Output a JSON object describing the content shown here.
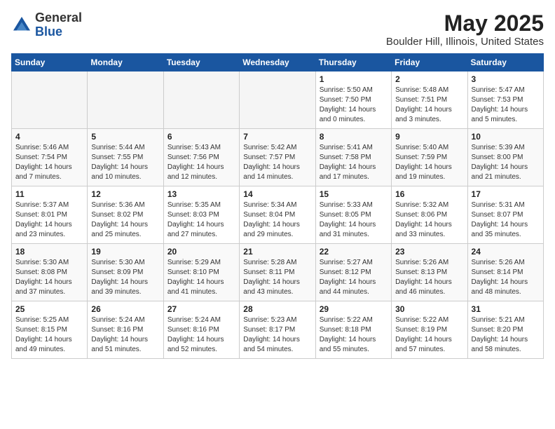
{
  "header": {
    "logo_line1": "General",
    "logo_line2": "Blue",
    "month": "May 2025",
    "location": "Boulder Hill, Illinois, United States"
  },
  "weekdays": [
    "Sunday",
    "Monday",
    "Tuesday",
    "Wednesday",
    "Thursday",
    "Friday",
    "Saturday"
  ],
  "weeks": [
    [
      {
        "day": "",
        "empty": true
      },
      {
        "day": "",
        "empty": true
      },
      {
        "day": "",
        "empty": true
      },
      {
        "day": "",
        "empty": true
      },
      {
        "day": "1",
        "sunrise": "5:50 AM",
        "sunset": "7:50 PM",
        "daylight": "14 hours and 0 minutes."
      },
      {
        "day": "2",
        "sunrise": "5:48 AM",
        "sunset": "7:51 PM",
        "daylight": "14 hours and 3 minutes."
      },
      {
        "day": "3",
        "sunrise": "5:47 AM",
        "sunset": "7:53 PM",
        "daylight": "14 hours and 5 minutes."
      }
    ],
    [
      {
        "day": "4",
        "sunrise": "5:46 AM",
        "sunset": "7:54 PM",
        "daylight": "14 hours and 7 minutes."
      },
      {
        "day": "5",
        "sunrise": "5:44 AM",
        "sunset": "7:55 PM",
        "daylight": "14 hours and 10 minutes."
      },
      {
        "day": "6",
        "sunrise": "5:43 AM",
        "sunset": "7:56 PM",
        "daylight": "14 hours and 12 minutes."
      },
      {
        "day": "7",
        "sunrise": "5:42 AM",
        "sunset": "7:57 PM",
        "daylight": "14 hours and 14 minutes."
      },
      {
        "day": "8",
        "sunrise": "5:41 AM",
        "sunset": "7:58 PM",
        "daylight": "14 hours and 17 minutes."
      },
      {
        "day": "9",
        "sunrise": "5:40 AM",
        "sunset": "7:59 PM",
        "daylight": "14 hours and 19 minutes."
      },
      {
        "day": "10",
        "sunrise": "5:39 AM",
        "sunset": "8:00 PM",
        "daylight": "14 hours and 21 minutes."
      }
    ],
    [
      {
        "day": "11",
        "sunrise": "5:37 AM",
        "sunset": "8:01 PM",
        "daylight": "14 hours and 23 minutes."
      },
      {
        "day": "12",
        "sunrise": "5:36 AM",
        "sunset": "8:02 PM",
        "daylight": "14 hours and 25 minutes."
      },
      {
        "day": "13",
        "sunrise": "5:35 AM",
        "sunset": "8:03 PM",
        "daylight": "14 hours and 27 minutes."
      },
      {
        "day": "14",
        "sunrise": "5:34 AM",
        "sunset": "8:04 PM",
        "daylight": "14 hours and 29 minutes."
      },
      {
        "day": "15",
        "sunrise": "5:33 AM",
        "sunset": "8:05 PM",
        "daylight": "14 hours and 31 minutes."
      },
      {
        "day": "16",
        "sunrise": "5:32 AM",
        "sunset": "8:06 PM",
        "daylight": "14 hours and 33 minutes."
      },
      {
        "day": "17",
        "sunrise": "5:31 AM",
        "sunset": "8:07 PM",
        "daylight": "14 hours and 35 minutes."
      }
    ],
    [
      {
        "day": "18",
        "sunrise": "5:30 AM",
        "sunset": "8:08 PM",
        "daylight": "14 hours and 37 minutes."
      },
      {
        "day": "19",
        "sunrise": "5:30 AM",
        "sunset": "8:09 PM",
        "daylight": "14 hours and 39 minutes."
      },
      {
        "day": "20",
        "sunrise": "5:29 AM",
        "sunset": "8:10 PM",
        "daylight": "14 hours and 41 minutes."
      },
      {
        "day": "21",
        "sunrise": "5:28 AM",
        "sunset": "8:11 PM",
        "daylight": "14 hours and 43 minutes."
      },
      {
        "day": "22",
        "sunrise": "5:27 AM",
        "sunset": "8:12 PM",
        "daylight": "14 hours and 44 minutes."
      },
      {
        "day": "23",
        "sunrise": "5:26 AM",
        "sunset": "8:13 PM",
        "daylight": "14 hours and 46 minutes."
      },
      {
        "day": "24",
        "sunrise": "5:26 AM",
        "sunset": "8:14 PM",
        "daylight": "14 hours and 48 minutes."
      }
    ],
    [
      {
        "day": "25",
        "sunrise": "5:25 AM",
        "sunset": "8:15 PM",
        "daylight": "14 hours and 49 minutes."
      },
      {
        "day": "26",
        "sunrise": "5:24 AM",
        "sunset": "8:16 PM",
        "daylight": "14 hours and 51 minutes."
      },
      {
        "day": "27",
        "sunrise": "5:24 AM",
        "sunset": "8:16 PM",
        "daylight": "14 hours and 52 minutes."
      },
      {
        "day": "28",
        "sunrise": "5:23 AM",
        "sunset": "8:17 PM",
        "daylight": "14 hours and 54 minutes."
      },
      {
        "day": "29",
        "sunrise": "5:22 AM",
        "sunset": "8:18 PM",
        "daylight": "14 hours and 55 minutes."
      },
      {
        "day": "30",
        "sunrise": "5:22 AM",
        "sunset": "8:19 PM",
        "daylight": "14 hours and 57 minutes."
      },
      {
        "day": "31",
        "sunrise": "5:21 AM",
        "sunset": "8:20 PM",
        "daylight": "14 hours and 58 minutes."
      }
    ]
  ]
}
